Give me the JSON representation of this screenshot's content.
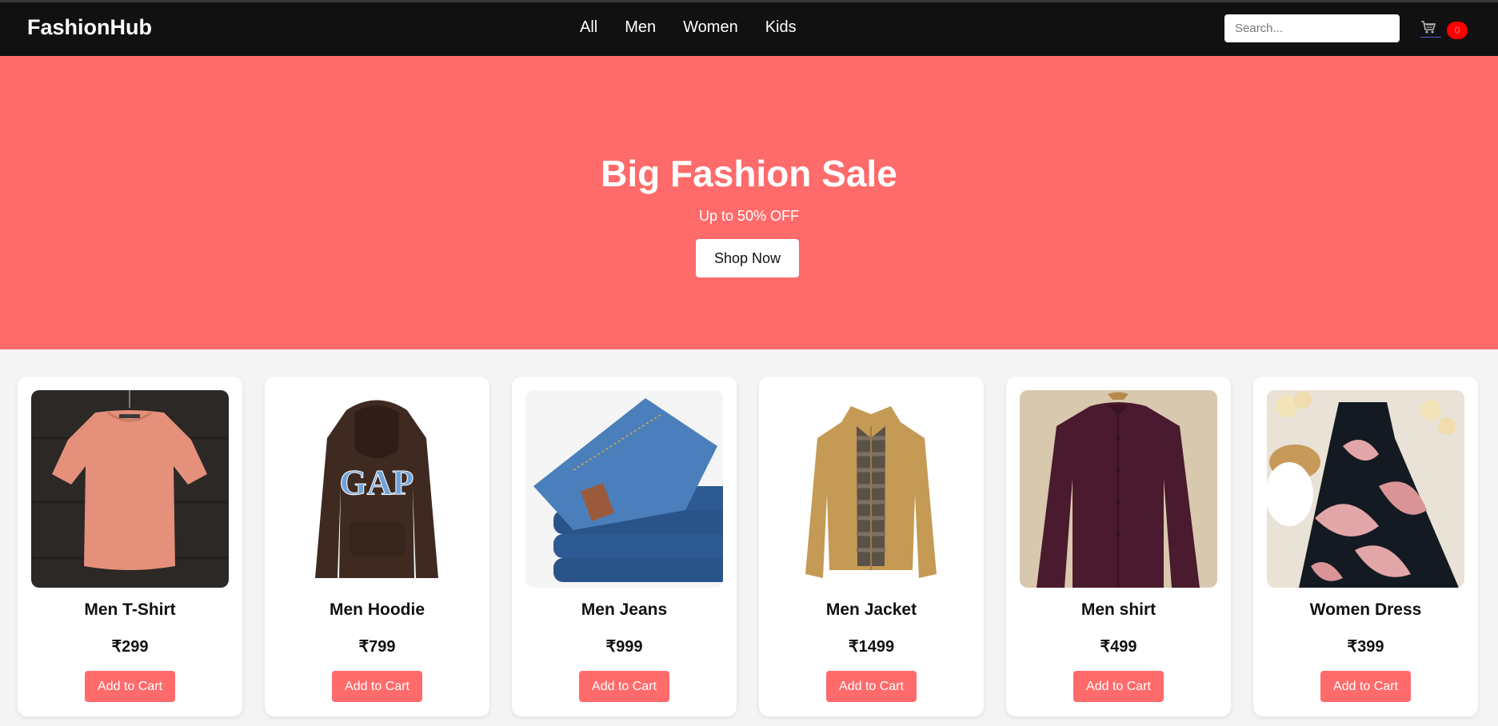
{
  "header": {
    "logo": "FashionHub",
    "nav": [
      "All",
      "Men",
      "Women",
      "Kids"
    ],
    "search_placeholder": "Search...",
    "cart_icon": "cart-icon",
    "cart_count": "0"
  },
  "hero": {
    "title": "Big Fashion Sale",
    "subtitle": "Up to 50% OFF",
    "button": "Shop Now"
  },
  "products": [
    {
      "name": "Men T-Shirt",
      "price": "₹299",
      "button": "Add to Cart"
    },
    {
      "name": "Men Hoodie",
      "price": "₹799",
      "button": "Add to Cart"
    },
    {
      "name": "Men Jeans",
      "price": "₹999",
      "button": "Add to Cart"
    },
    {
      "name": "Men Jacket",
      "price": "₹1499",
      "button": "Add to Cart"
    },
    {
      "name": "Men shirt",
      "price": "₹499",
      "button": "Add to Cart"
    },
    {
      "name": "Women Dress",
      "price": "₹399",
      "button": "Add to Cart"
    }
  ],
  "colors": {
    "accent": "#ff6b6b",
    "navbar": "#111111",
    "badge": "#ff0000"
  }
}
